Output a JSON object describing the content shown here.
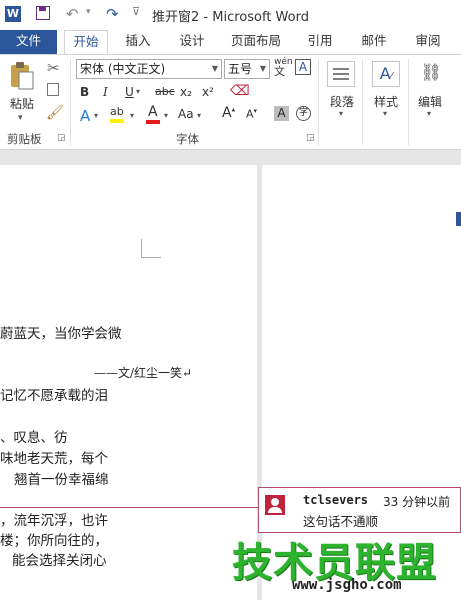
{
  "window": {
    "title": "推开窗2 - Microsoft Word",
    "word_icon_text": "W"
  },
  "tabs": [
    "文件",
    "开始",
    "插入",
    "设计",
    "页面布局",
    "引用",
    "邮件",
    "审阅"
  ],
  "ribbon": {
    "clipboard": {
      "paste_label": "粘贴",
      "group_label": "剪贴板"
    },
    "font": {
      "font_name": "宋体 (中文正文)",
      "font_size": "五号",
      "phonetic_label": "wén",
      "group_label": "字体",
      "bold": "B",
      "italic": "I",
      "underline": "U",
      "strikethrough": "abc",
      "subscript": "x₂",
      "superscript": "x²",
      "text_effects": "A",
      "highlight": "ab",
      "font_color": "A",
      "change_case": "Aa",
      "grow": "A",
      "shrink": "A",
      "shade": "A",
      "enclose": "字"
    },
    "paragraph": {
      "label": "段落"
    },
    "styles": {
      "label": "样式"
    },
    "editing": {
      "label": "编辑"
    }
  },
  "document": {
    "lines": [
      "蔚蓝天，当你学会微",
      "——文/红尘一笑↵",
      "记忆不愿承载的泪",
      "、叹息、彷",
      "味地老天荒，每个",
      "翘首一份幸福绵",
      "，流年沉浮，也许",
      "楼；你所向往的，",
      "能会选择关闭心"
    ]
  },
  "comment": {
    "author": "tclsevers",
    "time": "33 分钟以前",
    "text": "这句话不通顺"
  },
  "watermark": {
    "brand": "技术员联盟",
    "url": "www.jsgho.com"
  }
}
